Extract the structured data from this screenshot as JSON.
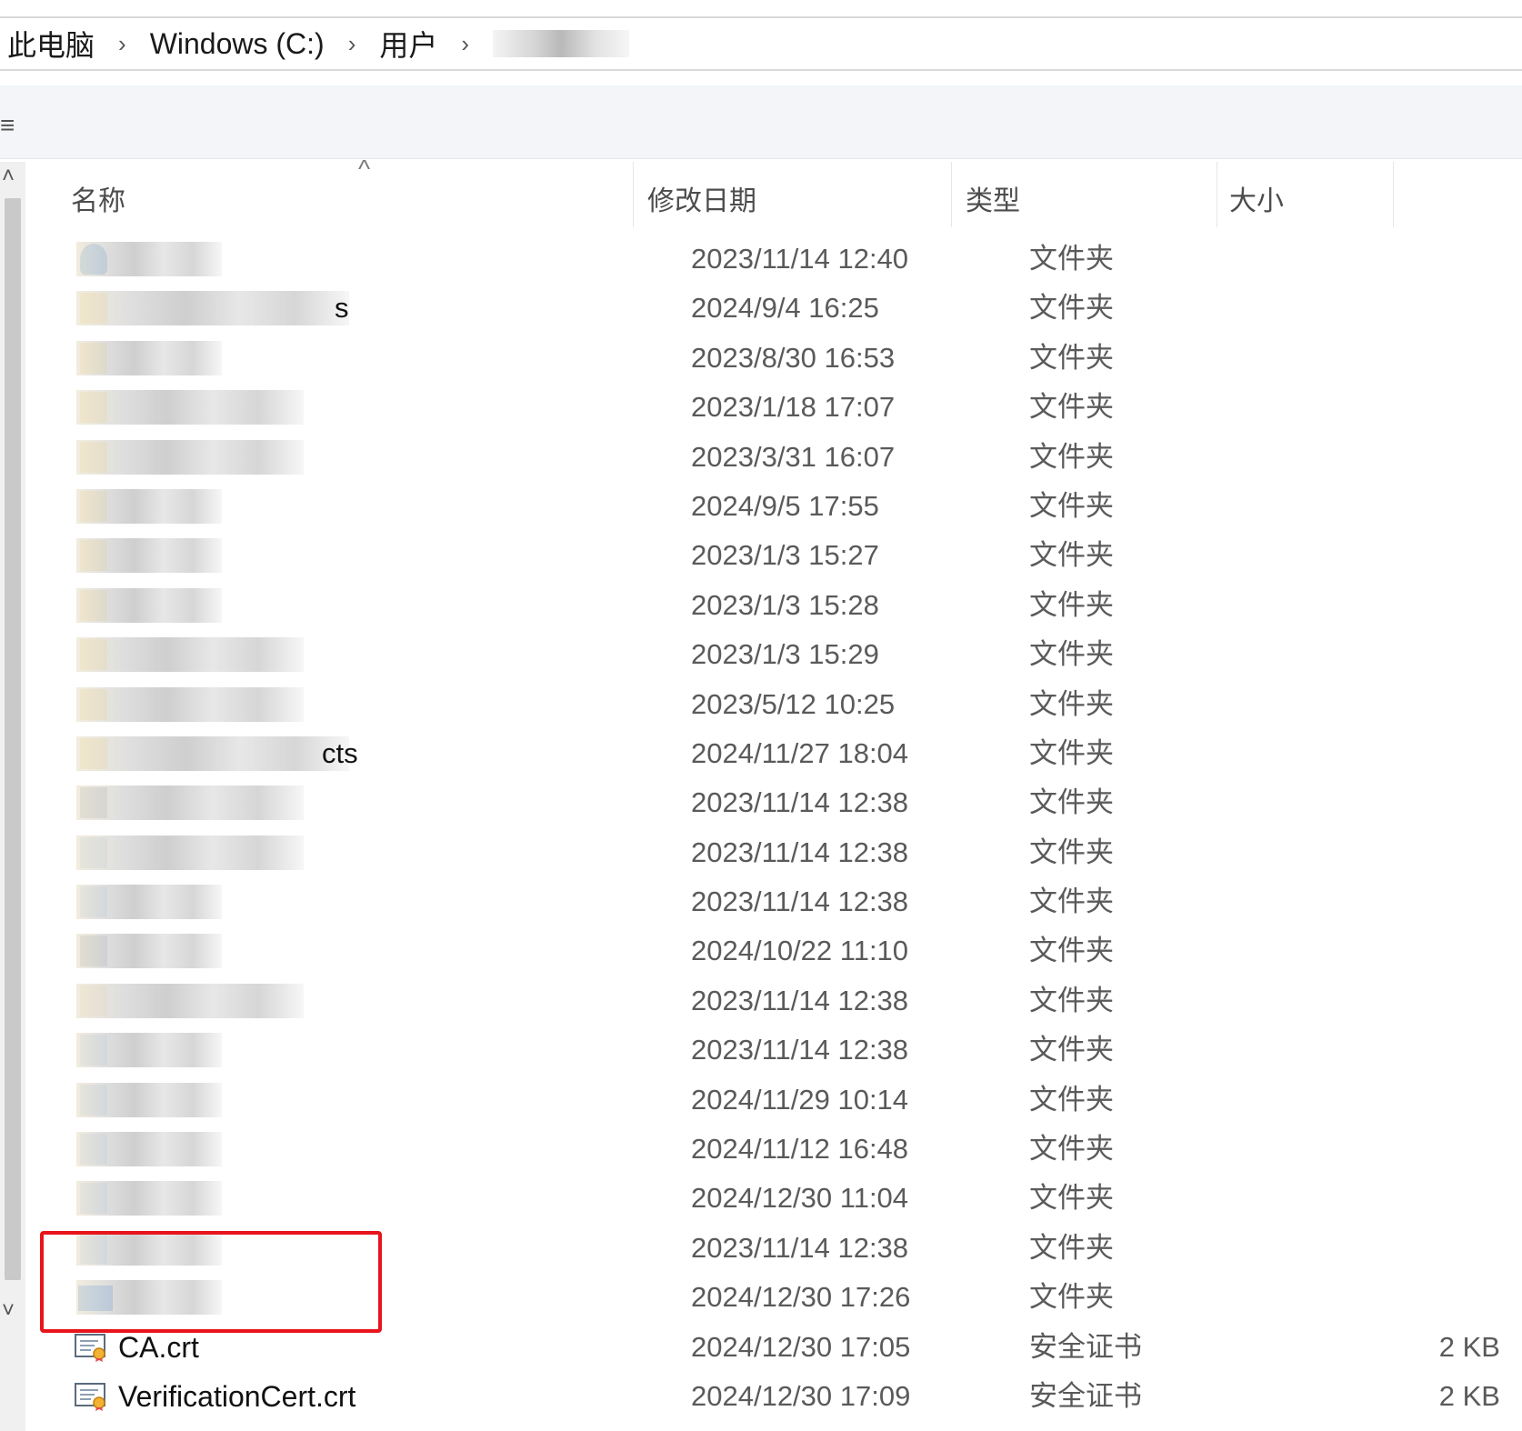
{
  "breadcrumb": [
    "此电脑",
    "Windows (C:)",
    "用户"
  ],
  "breadcrumb_sep": "›",
  "command_icon": "≡",
  "columns": {
    "name": "名称",
    "date": "修改日期",
    "type": "类型",
    "size": "大小"
  },
  "sort_indicator": "^",
  "rows": [
    {
      "date": "2023/11/14 12:40",
      "type": "文件夹",
      "size": "",
      "icon": "cloud-folder-icon",
      "name_tail": ""
    },
    {
      "date": "2024/9/4 16:25",
      "type": "文件夹",
      "size": "",
      "icon": "folder-icon",
      "name_tail": "s"
    },
    {
      "date": "2023/8/30 16:53",
      "type": "文件夹",
      "size": "",
      "icon": "folder-icon",
      "name_tail": ""
    },
    {
      "date": "2023/1/18 17:07",
      "type": "文件夹",
      "size": "",
      "icon": "folder-icon",
      "name_tail": ""
    },
    {
      "date": "2023/3/31 16:07",
      "type": "文件夹",
      "size": "",
      "icon": "folder-icon",
      "name_tail": ""
    },
    {
      "date": "2024/9/5 17:55",
      "type": "文件夹",
      "size": "",
      "icon": "folder-icon",
      "name_tail": ""
    },
    {
      "date": "2023/1/3 15:27",
      "type": "文件夹",
      "size": "",
      "icon": "folder-icon",
      "name_tail": ""
    },
    {
      "date": "2023/1/3 15:28",
      "type": "文件夹",
      "size": "",
      "icon": "folder-icon",
      "name_tail": ""
    },
    {
      "date": "2023/1/3 15:29",
      "type": "文件夹",
      "size": "",
      "icon": "folder-icon",
      "name_tail": ""
    },
    {
      "date": "2023/5/12 10:25",
      "type": "文件夹",
      "size": "",
      "icon": "folder-icon",
      "name_tail": ""
    },
    {
      "date": "2024/11/27 18:04",
      "type": "文件夹",
      "size": "",
      "icon": "folder-icon",
      "name_tail": "cts"
    },
    {
      "date": "2023/11/14 12:38",
      "type": "文件夹",
      "size": "",
      "icon": "contacts-folder-icon",
      "name_tail": ""
    },
    {
      "date": "2023/11/14 12:38",
      "type": "文件夹",
      "size": "",
      "icon": "desktop-folder-icon",
      "name_tail": ""
    },
    {
      "date": "2023/11/14 12:38",
      "type": "文件夹",
      "size": "",
      "icon": "documents-folder-icon",
      "name_tail": ""
    },
    {
      "date": "2024/10/22 11:10",
      "type": "文件夹",
      "size": "",
      "icon": "downloads-folder-icon",
      "name_tail": ""
    },
    {
      "date": "2023/11/14 12:38",
      "type": "文件夹",
      "size": "",
      "icon": "favorites-folder-icon",
      "name_tail": ""
    },
    {
      "date": "2023/11/14 12:38",
      "type": "文件夹",
      "size": "",
      "icon": "links-folder-icon",
      "name_tail": ""
    },
    {
      "date": "2024/11/29 10:14",
      "type": "文件夹",
      "size": "",
      "icon": "music-folder-icon",
      "name_tail": ""
    },
    {
      "date": "2024/11/12 16:48",
      "type": "文件夹",
      "size": "",
      "icon": "onedrive-folder-icon",
      "name_tail": ""
    },
    {
      "date": "2024/12/30 11:04",
      "type": "文件夹",
      "size": "",
      "icon": "pictures-folder-icon",
      "name_tail": ""
    },
    {
      "date": "2023/11/14 12:38",
      "type": "文件夹",
      "size": "",
      "icon": "videos-folder-icon",
      "name_tail": ""
    },
    {
      "date": "2024/12/30 17:26",
      "type": "文件夹",
      "size": "",
      "icon": "desktop-folder-icon",
      "name_tail": ""
    },
    {
      "date": "2024/12/30 17:05",
      "type": "安全证书",
      "size": "2 KB",
      "icon": "certificate-icon",
      "name": "CA.crt"
    },
    {
      "date": "2024/12/30 17:09",
      "type": "安全证书",
      "size": "2 KB",
      "icon": "certificate-icon",
      "name": "VerificationCert.crt"
    }
  ],
  "highlight_color": "#e8141c"
}
